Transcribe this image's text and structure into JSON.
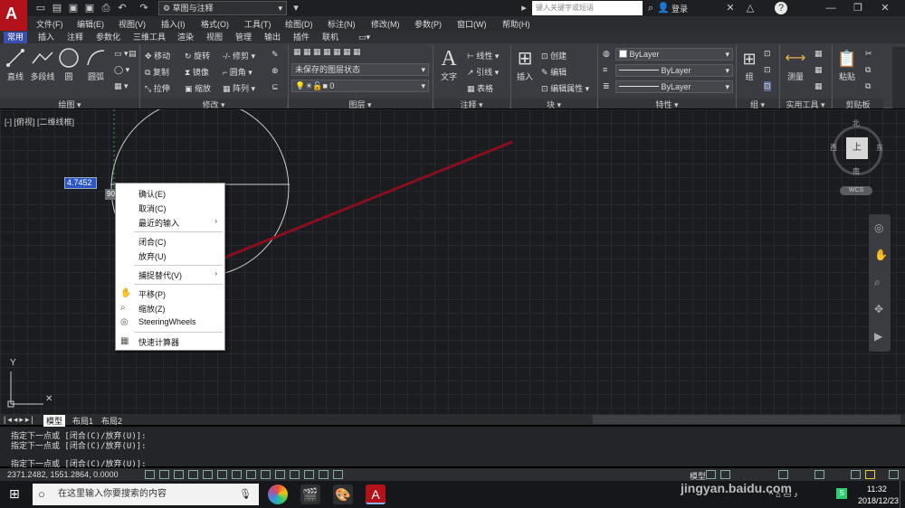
{
  "titlebar": {
    "workspace": "草图与注释",
    "search_placeholder": "键入关键字或短语",
    "login": "登录"
  },
  "menubar": [
    "文件(F)",
    "编辑(E)",
    "视图(V)",
    "插入(I)",
    "格式(O)",
    "工具(T)",
    "绘图(D)",
    "标注(N)",
    "修改(M)",
    "参数(P)",
    "窗口(W)",
    "帮助(H)"
  ],
  "ribbon_tabs": [
    "常用",
    "插入",
    "注释",
    "参数化",
    "三维工具",
    "渲染",
    "视图",
    "管理",
    "输出",
    "插件",
    "联机"
  ],
  "active_tab": "常用",
  "ribbon": {
    "draw": {
      "title": "绘图",
      "tools": [
        "直线",
        "多段线",
        "圆",
        "圆弧"
      ]
    },
    "modify": {
      "title": "修改",
      "tools": [
        "移动",
        "旋转",
        "修剪",
        "复制",
        "镜像",
        "圆角",
        "拉伸",
        "缩放",
        "阵列"
      ]
    },
    "layer": {
      "title": "图层",
      "state": "未保存的图层状态",
      "current": "0"
    },
    "annotation": {
      "title": "注释",
      "text": "文字",
      "tools": [
        "线性",
        "引线",
        "表格"
      ]
    },
    "block": {
      "title": "块",
      "insert": "插入",
      "tools": [
        "创建",
        "编辑",
        "编辑属性"
      ]
    },
    "properties": {
      "title": "特性",
      "color": "ByLayer",
      "linetype": "ByLayer",
      "lineweight": "ByLayer"
    },
    "group": {
      "title": "组",
      "label": "组"
    },
    "utilities": {
      "title": "实用工具",
      "measure": "测量"
    },
    "clipboard": {
      "title": "剪贴板",
      "paste": "粘贴"
    }
  },
  "viewport": {
    "label": "[-] [俯视] [二维线框]",
    "dynamic_input": "4.7452",
    "angle_tip": "90"
  },
  "viewcube": {
    "north": "北",
    "south": "南",
    "east": "东",
    "west": "西",
    "face": "上",
    "wcs": "WCS"
  },
  "context_menu": [
    {
      "label": "确认(E)",
      "icon": ""
    },
    {
      "label": "取消(C)",
      "icon": ""
    },
    {
      "label": "最近的输入",
      "icon": "",
      "submenu": true
    },
    {
      "label": "闭合(C)",
      "icon": ""
    },
    {
      "label": "放弃(U)",
      "icon": ""
    },
    {
      "label": "捕捉替代(V)",
      "icon": "",
      "submenu": true
    },
    {
      "label": "平移(P)",
      "icon": "pan-icon"
    },
    {
      "label": "缩放(Z)",
      "icon": "zoom-icon"
    },
    {
      "label": "SteeringWheels",
      "icon": "steeringwheel-icon"
    },
    {
      "label": "快速计算器",
      "icon": "calculator-icon"
    }
  ],
  "layout_tabs": [
    "模型",
    "布局1",
    "布局2"
  ],
  "command_history": [
    "指定下一点或 [闭合(C)/放弃(U)]:",
    "指定下一点或 [闭合(C)/放弃(U)]:",
    "指定下一点或 [闭合(C)/放弃(U)]:"
  ],
  "status": {
    "coords": "2371.2482, 1551.2864, 0.0000",
    "model": "模型"
  },
  "taskbar": {
    "search_placeholder": "在这里输入你要搜索的内容",
    "time": "11:32",
    "date": "2018/12/23"
  },
  "watermark": {
    "brand": "Baidu",
    "brand_cn": "经验",
    "url": "jingyan.baidu.com"
  },
  "colors": {
    "accent": "#3b4dad",
    "arrow": "#8b0e1e",
    "logo": "#b3121b"
  }
}
